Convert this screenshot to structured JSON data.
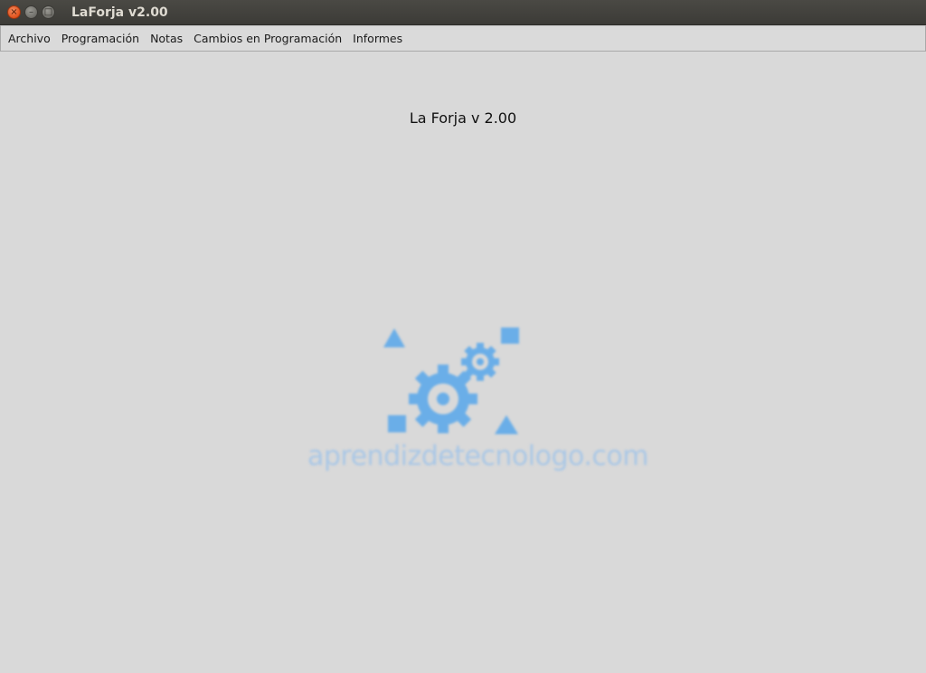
{
  "window": {
    "title": "LaForja v2.00",
    "buttons": {
      "close": "×",
      "minimize": "–",
      "maximize": "□"
    }
  },
  "menubar": {
    "items": [
      {
        "label": "Archivo"
      },
      {
        "label": "Programación"
      },
      {
        "label": "Notas"
      },
      {
        "label": "Cambios en Programación"
      },
      {
        "label": "Informes"
      }
    ]
  },
  "main": {
    "heading": "La Forja v 2.00",
    "logo": {
      "text": "aprendizdetecnologo.com",
      "icon": "gears-and-shapes-logo",
      "color": "#6aaee8"
    }
  }
}
